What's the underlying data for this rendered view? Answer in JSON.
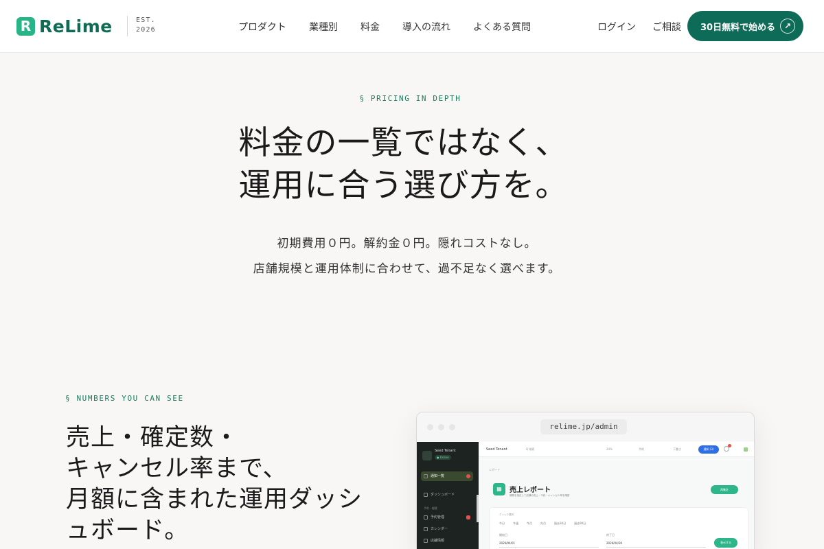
{
  "header": {
    "logo_mark": "R",
    "logo_text": "ReLime",
    "est_label": "EST.",
    "est_year": "2026",
    "nav": [
      "プロダクト",
      "業種別",
      "料金",
      "導入の流れ",
      "よくある質問"
    ],
    "login": "ログイン",
    "consult": "ご相談",
    "cta_label": "30日無料で始める",
    "cta_icon": "↗"
  },
  "hero": {
    "eyebrow": "§ PRICING IN DEPTH",
    "title_line1": "料金の一覧ではなく、",
    "title_line2": "運用に合う選び方を。",
    "sub_line1": "初期費用０円。解約金０円。隠れコストなし。",
    "sub_line2": "店舗規模と運用体制に合わせて、過不足なく選べます。"
  },
  "numbers": {
    "eyebrow": "§ NUMBERS YOU CAN SEE",
    "title_line1": "売上・確定数・",
    "title_line2": "キャンセル率まで、",
    "title_line3": "月額に含まれた運用ダッシ",
    "title_line4": "ュボード。"
  },
  "browser": {
    "url": "relime.jp/admin",
    "tenant_name": "Seed Tenant",
    "tenant_status": "● Online",
    "side_items": [
      "通知一覧",
      "ダッシュボード",
      "予約管理",
      "カレンダー",
      "店舗情報"
    ],
    "side_section": "予約・顧客",
    "topbar_tenant": "Seed Tenant",
    "topbar_items": [
      "Q 検索",
      "24%",
      "予約",
      "下書き"
    ],
    "topbar_pill": "通知 (3)",
    "breadcrumb": "レポート",
    "report_title": "売上レポート",
    "report_desc": "期間を指定して店舗の売上・予約・キャンセル率を確認",
    "refresh_button": "再集計",
    "filter_label": "クイック選択",
    "chips": [
      "今日",
      "今週",
      "今月",
      "先月",
      "過去30日",
      "過去90日"
    ],
    "start_label": "開始日",
    "start_value": "2026/04/01",
    "end_label": "終了日",
    "end_value": "2026/04/30",
    "apply_button": "表示する"
  },
  "colors": {
    "brand": "#0e6b57",
    "accent": "#27b487",
    "background": "#f8f7f5"
  }
}
